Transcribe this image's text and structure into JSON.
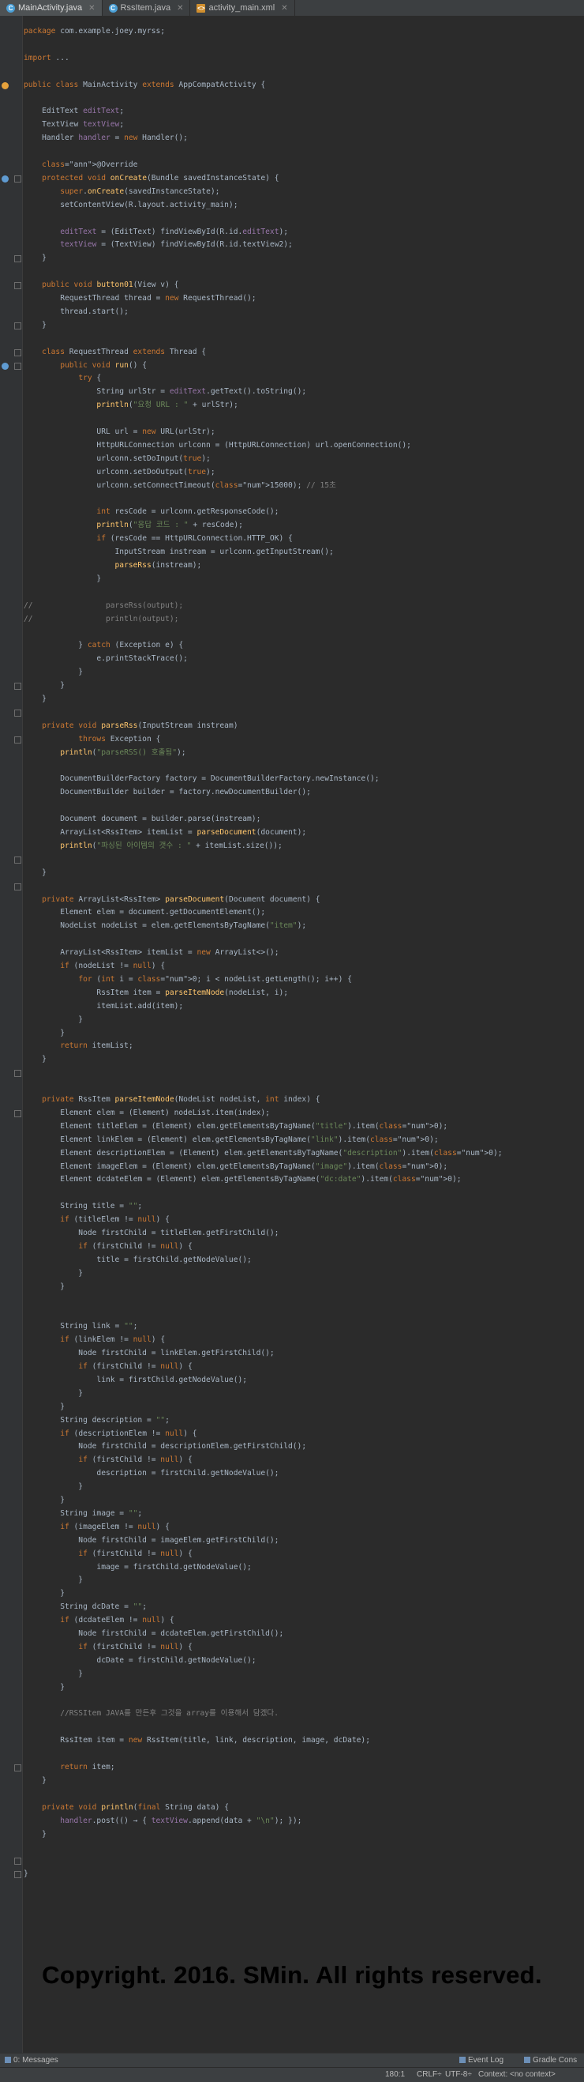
{
  "tabs": [
    {
      "label": "MainActivity.java",
      "active": true
    },
    {
      "label": "RssItem.java",
      "active": false
    },
    {
      "label": "activity_main.xml",
      "active": false
    }
  ],
  "code": [
    "package com.example.joey.myrss;",
    "",
    "import ...",
    "",
    "public class MainActivity extends AppCompatActivity {",
    "",
    "    EditText editText;",
    "    TextView textView;",
    "    Handler handler = new Handler();",
    "",
    "    @Override",
    "    protected void onCreate(Bundle savedInstanceState) {",
    "        super.onCreate(savedInstanceState);",
    "        setContentView(R.layout.activity_main);",
    "",
    "        editText = (EditText) findViewById(R.id.editText);",
    "        textView = (TextView) findViewById(R.id.textView2);",
    "    }",
    "",
    "    public void button01(View v) {",
    "        RequestThread thread = new RequestThread();",
    "        thread.start();",
    "    }",
    "",
    "    class RequestThread extends Thread {",
    "        public void run() {",
    "            try {",
    "                String urlStr = editText.getText().toString();",
    "                println(\"요청 URL : \" + urlStr);",
    "",
    "                URL url = new URL(urlStr);",
    "                HttpURLConnection urlconn = (HttpURLConnection) url.openConnection();",
    "                urlconn.setDoInput(true);",
    "                urlconn.setDoOutput(true);",
    "                urlconn.setConnectTimeout(15000); // 15초",
    "",
    "                int resCode = urlconn.getResponseCode();",
    "                println(\"응답 코드 : \" + resCode);",
    "                if (resCode == HttpURLConnection.HTTP_OK) {",
    "                    InputStream instream = urlconn.getInputStream();",
    "                    parseRss(instream);",
    "                }",
    "",
    "//                parseRss(output);",
    "//                println(output);",
    "",
    "            } catch (Exception e) {",
    "                e.printStackTrace();",
    "            }",
    "        }",
    "    }",
    "",
    "    private void parseRss(InputStream instream)",
    "            throws Exception {",
    "        println(\"parseRSS() 호출됨\");",
    "",
    "        DocumentBuilderFactory factory = DocumentBuilderFactory.newInstance();",
    "        DocumentBuilder builder = factory.newDocumentBuilder();",
    "",
    "        Document document = builder.parse(instream);",
    "        ArrayList<RssItem> itemList = parseDocument(document);",
    "        println(\"파싱된 아이템의 갯수 : \" + itemList.size());",
    "",
    "    }",
    "",
    "    private ArrayList<RssItem> parseDocument(Document document) {",
    "        Element elem = document.getDocumentElement();",
    "        NodeList nodeList = elem.getElementsByTagName(\"item\");",
    "",
    "        ArrayList<RssItem> itemList = new ArrayList<>();",
    "        if (nodeList != null) {",
    "            for (int i = 0; i < nodeList.getLength(); i++) {",
    "                RssItem item = parseItemNode(nodeList, i);",
    "                itemList.add(item);",
    "            }",
    "        }",
    "        return itemList;",
    "    }",
    "",
    "",
    "    private RssItem parseItemNode(NodeList nodeList, int index) {",
    "        Element elem = (Element) nodeList.item(index);",
    "        Element titleElem = (Element) elem.getElementsByTagName(\"title\").item(0);",
    "        Element linkElem = (Element) elem.getElementsByTagName(\"link\").item(0);",
    "        Element descriptionElem = (Element) elem.getElementsByTagName(\"description\").item(0);",
    "        Element imageElem = (Element) elem.getElementsByTagName(\"image\").item(0);",
    "        Element dcdateElem = (Element) elem.getElementsByTagName(\"dc:date\").item(0);",
    "",
    "        String title = \"\";",
    "        if (titleElem != null) {",
    "            Node firstChild = titleElem.getFirstChild();",
    "            if (firstChild != null) {",
    "                title = firstChild.getNodeValue();",
    "            }",
    "        }",
    "",
    "",
    "        String link = \"\";",
    "        if (linkElem != null) {",
    "            Node firstChild = linkElem.getFirstChild();",
    "            if (firstChild != null) {",
    "                link = firstChild.getNodeValue();",
    "            }",
    "        }",
    "        String description = \"\";",
    "        if (descriptionElem != null) {",
    "            Node firstChild = descriptionElem.getFirstChild();",
    "            if (firstChild != null) {",
    "                description = firstChild.getNodeValue();",
    "            }",
    "        }",
    "        String image = \"\";",
    "        if (imageElem != null) {",
    "            Node firstChild = imageElem.getFirstChild();",
    "            if (firstChild != null) {",
    "                image = firstChild.getNodeValue();",
    "            }",
    "        }",
    "        String dcDate = \"\";",
    "        if (dcdateElem != null) {",
    "            Node firstChild = dcdateElem.getFirstChild();",
    "            if (firstChild != null) {",
    "                dcDate = firstChild.getNodeValue();",
    "            }",
    "        }",
    "",
    "        //RSSItem JAVA를 만든후 그것을 array를 이용해서 담겠다.",
    "",
    "        RssItem item = new RssItem(title, link, description, image, dcDate);",
    "",
    "        return item;",
    "    }",
    "",
    "    private void println(final String data) {",
    "        handler.post(() → { textView.append(data + \"\\n\"); });",
    "    }",
    "",
    "",
    "}"
  ],
  "copyright": "Copyright. 2016. SMin. All rights reserved.",
  "bottom_panel": {
    "messages": "0: Messages",
    "event_log": "Event Log",
    "gradle_console": "Gradle Cons"
  },
  "status": {
    "position": "180:1",
    "line_sep": "CRLF÷",
    "encoding": "UTF-8÷",
    "context": "Context: <no context>"
  },
  "colors": {
    "background": "#2b2b2b",
    "keyword": "#cc7832",
    "string": "#6a8759",
    "field": "#9876aa",
    "method": "#ffc66d",
    "comment": "#808080",
    "number": "#6897bb",
    "annotation": "#bbb529"
  }
}
